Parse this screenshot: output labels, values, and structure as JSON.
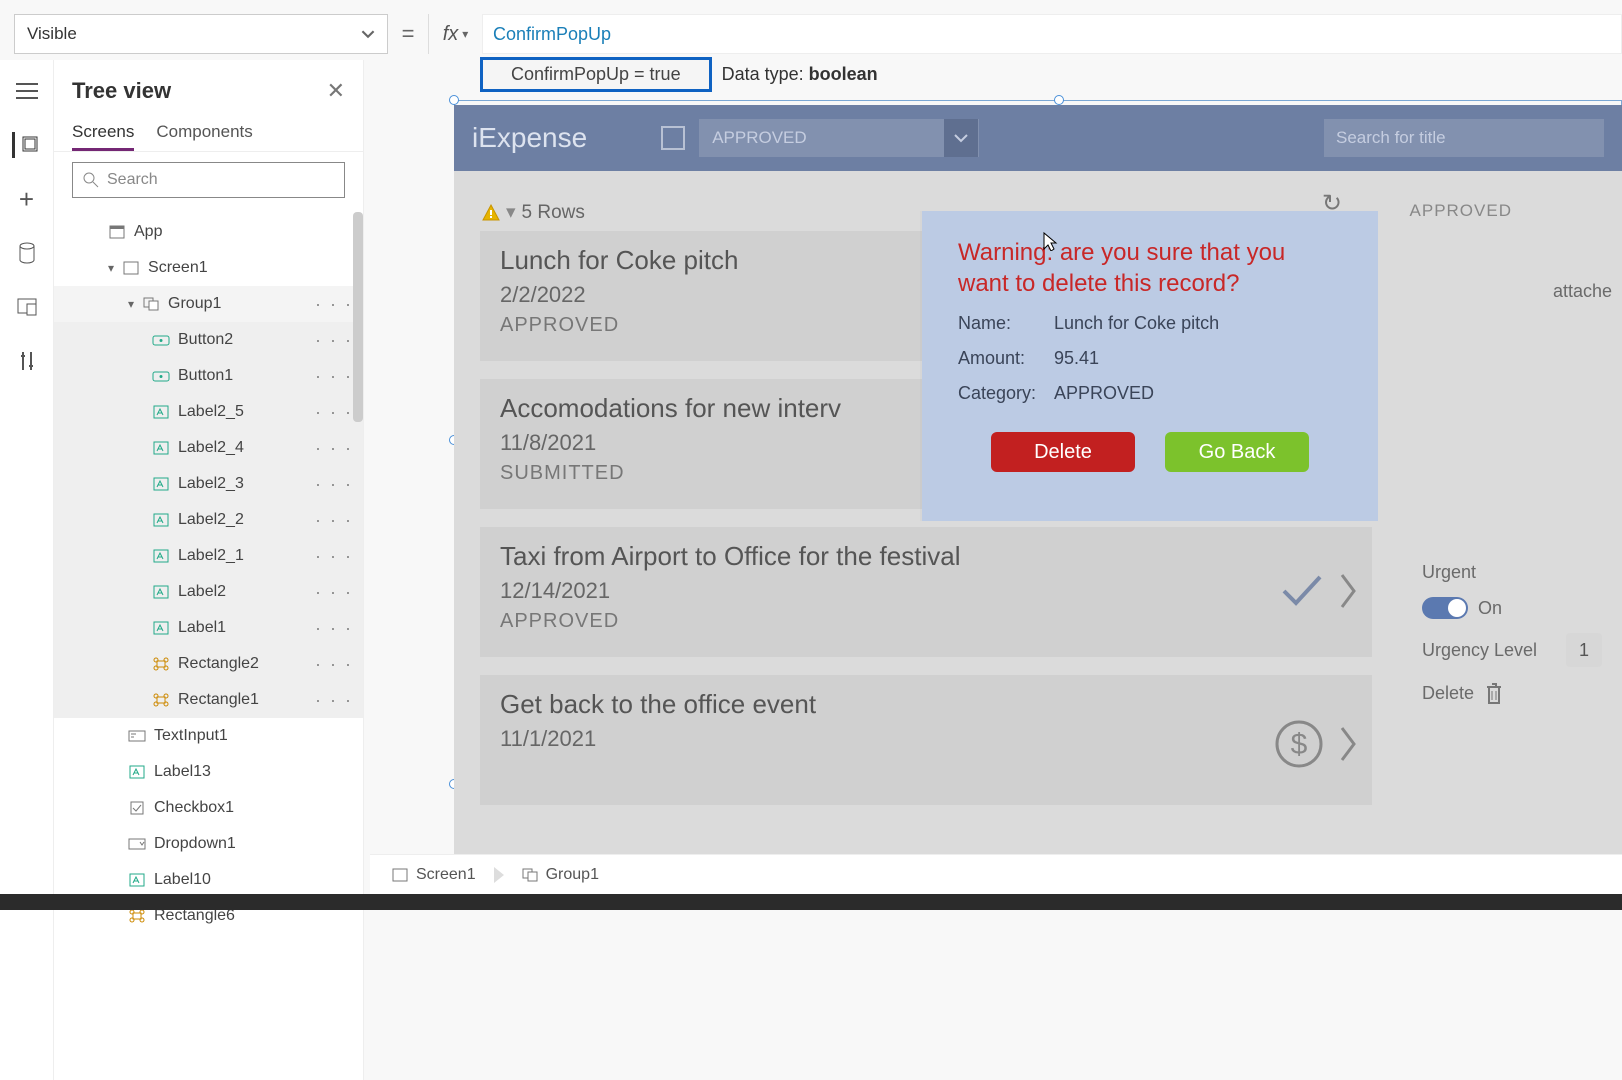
{
  "topbar": {
    "property": "Visible",
    "formula": "ConfirmPopUp",
    "eval": "ConfirmPopUp  =  true",
    "datatype_prefix": "Data type: ",
    "datatype": "boolean"
  },
  "tree": {
    "title": "Tree view",
    "tab_screens": "Screens",
    "tab_components": "Components",
    "search_placeholder": "Search",
    "items": [
      {
        "label": "App",
        "icon": "app",
        "indent": 1,
        "chev": false
      },
      {
        "label": "Screen1",
        "icon": "screen",
        "indent": 1,
        "chev": true
      },
      {
        "label": "Group1",
        "icon": "group",
        "indent": 2,
        "chev": true,
        "dots": true,
        "sel": true
      },
      {
        "label": "Button2",
        "icon": "button",
        "indent": 3,
        "dots": true,
        "group": true
      },
      {
        "label": "Button1",
        "icon": "button",
        "indent": 3,
        "dots": true,
        "group": true
      },
      {
        "label": "Label2_5",
        "icon": "label",
        "indent": 3,
        "dots": true,
        "group": true
      },
      {
        "label": "Label2_4",
        "icon": "label",
        "indent": 3,
        "dots": true,
        "group": true
      },
      {
        "label": "Label2_3",
        "icon": "label",
        "indent": 3,
        "dots": true,
        "group": true
      },
      {
        "label": "Label2_2",
        "icon": "label",
        "indent": 3,
        "dots": true,
        "group": true
      },
      {
        "label": "Label2_1",
        "icon": "label",
        "indent": 3,
        "dots": true,
        "group": true
      },
      {
        "label": "Label2",
        "icon": "label",
        "indent": 3,
        "dots": true,
        "group": true
      },
      {
        "label": "Label1",
        "icon": "label",
        "indent": 3,
        "dots": true,
        "group": true
      },
      {
        "label": "Rectangle2",
        "icon": "rect",
        "indent": 3,
        "dots": true,
        "group": true
      },
      {
        "label": "Rectangle1",
        "icon": "rect",
        "indent": 3,
        "dots": true,
        "group": true
      },
      {
        "label": "TextInput1",
        "icon": "textinput",
        "indent": 2
      },
      {
        "label": "Label13",
        "icon": "label",
        "indent": 2
      },
      {
        "label": "Checkbox1",
        "icon": "checkbox",
        "indent": 2
      },
      {
        "label": "Dropdown1",
        "icon": "dropdown",
        "indent": 2
      },
      {
        "label": "Label10",
        "icon": "label",
        "indent": 2
      },
      {
        "label": "Rectangle6",
        "icon": "rect",
        "indent": 2
      }
    ]
  },
  "app": {
    "title": "iExpense",
    "dropdown_value": "APPROVED",
    "search_placeholder": "Search for title",
    "rows_label": "5 Rows",
    "badge_approved": "APPROVED",
    "list": [
      {
        "title": "Lunch for Coke pitch",
        "date": "2/2/2022",
        "status": "APPROVED"
      },
      {
        "title": "Accomodations for new interv",
        "date": "11/8/2021",
        "status": "SUBMITTED"
      },
      {
        "title": "Taxi from Airport to Office for the festival",
        "date": "12/14/2021",
        "status": "APPROVED"
      },
      {
        "title": "Get back to the office event",
        "date": "11/1/2021",
        "status": ""
      }
    ],
    "side": {
      "attach": "attache",
      "urgent_label": "Urgent",
      "urgent_value": "On",
      "urgency_label": "Urgency Level",
      "urgency_value": "1",
      "delete_label": "Delete"
    }
  },
  "popup": {
    "warning": "Warning: are you sure that you want to delete this record?",
    "name_k": "Name:",
    "name_v": "Lunch for Coke pitch",
    "amount_k": "Amount:",
    "amount_v": "95.41",
    "cat_k": "Category:",
    "cat_v": "APPROVED",
    "delete": "Delete",
    "goback": "Go Back"
  },
  "breadcrumb": {
    "seg1": "Screen1",
    "seg2": "Group1"
  }
}
